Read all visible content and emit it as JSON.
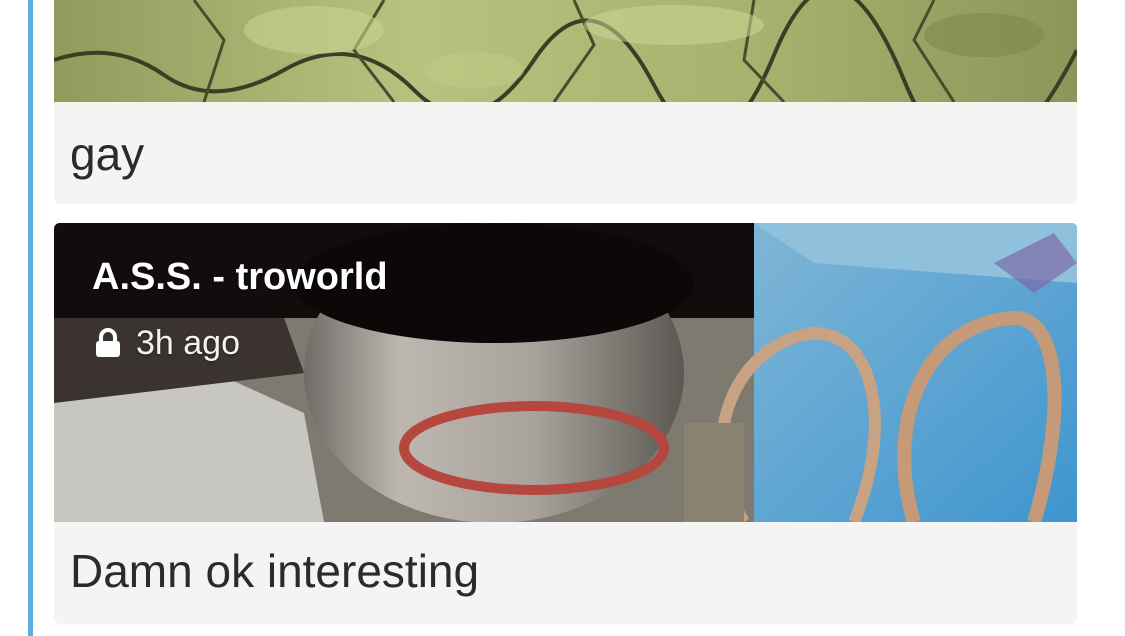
{
  "accent_color": "#5eaee3",
  "feed": {
    "posts": [
      {
        "caption": "gay",
        "media_icon": "photo-thumbnail"
      },
      {
        "author": "A.S.S. - troworld",
        "privacy_icon": "lock-icon",
        "timestamp": "3h ago",
        "caption": "Damn ok interesting",
        "media_icon": "photo-thumbnail"
      }
    ]
  }
}
